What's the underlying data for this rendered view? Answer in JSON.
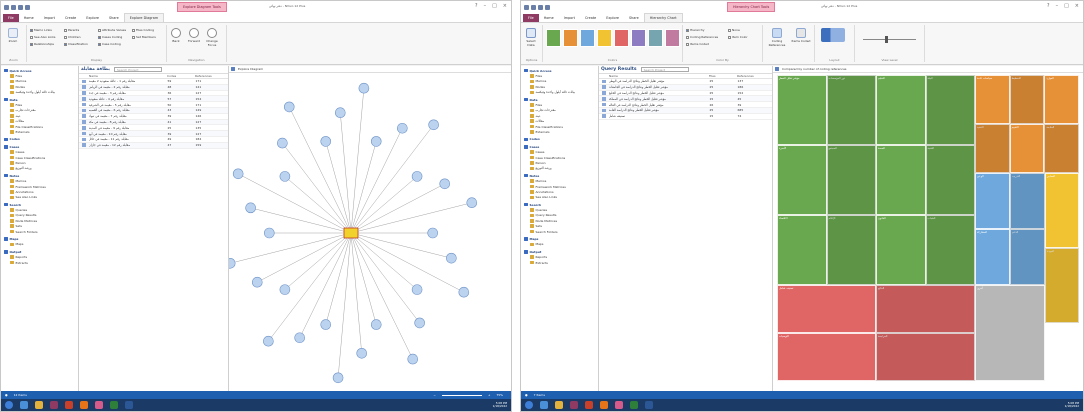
{
  "window1": {
    "title": "دفتر نهائي - NVivo 12 Plus",
    "context_tab": "Explore Diagram Tools",
    "ribbon_tabs": [
      "File",
      "Home",
      "Import",
      "Create",
      "Explore",
      "Share",
      "Explore Diagram"
    ],
    "ribbon": {
      "zoom": "Zoom",
      "show_group": [
        {
          "label": "Memo Links",
          "on": true
        },
        {
          "label": "See Also Links",
          "on": false
        },
        {
          "label": "Relationships",
          "on": true
        },
        {
          "label": "Parents",
          "on": false
        },
        {
          "label": "Children",
          "on": false
        },
        {
          "label": "Classification",
          "on": true
        },
        {
          "label": "Attribute Values",
          "on": false
        },
        {
          "label": "Cases Coding",
          "on": true
        },
        {
          "label": "Case Coding",
          "on": true
        },
        {
          "label": "Files Coding",
          "on": false
        },
        {
          "label": "Set Members",
          "on": false
        }
      ],
      "group_labels": [
        "Zoom",
        "Display",
        "Navigation"
      ],
      "nav_buttons": [
        "Back",
        "Forward",
        "Change Focus"
      ]
    },
    "nav": {
      "sections": [
        {
          "title": "Quick Access",
          "items": [
            "Files",
            "Memos",
            "Nodes",
            "بيانات ثالثة أيلول واحدة وفيكسة"
          ]
        },
        {
          "title": "Data",
          "items": [
            "Files",
            "مقترحات تجارب",
            "عينة",
            "مقالات",
            "File Classifications",
            "Externals"
          ]
        },
        {
          "title": "Codes",
          "items": []
        },
        {
          "title": "Cases",
          "items": [
            "Cases",
            "Case Classifications",
            "Person",
            "ورشة التوزيع"
          ]
        },
        {
          "title": "Notes",
          "items": [
            "Memos",
            "Framework Matrices",
            "Annotations",
            "See Also Links"
          ]
        },
        {
          "title": "Search",
          "items": [
            "Queries",
            "Query Results",
            "Node Matrices",
            "Sets",
            "Search Folders"
          ]
        },
        {
          "title": "Maps",
          "items": [
            "Maps"
          ]
        },
        {
          "title": "Output",
          "items": [
            "Reports",
            "Extracts"
          ]
        }
      ]
    },
    "list": {
      "title": "بطاقة مقابلة",
      "search_placeholder": "Search Project",
      "columns": [
        "Name",
        "Codes",
        "References"
      ],
      "rows": [
        {
          "name": "مقابلة رقم 1 - عائلة سعودية 2 مقيمة",
          "codes": "59",
          "refs": "171"
        },
        {
          "name": "مقابلة رقم 2 - مقيمة في الرياض",
          "codes": "48",
          "refs": "141"
        },
        {
          "name": "مقابلة رقم 3 - مقيمة في جدة",
          "codes": "36",
          "refs": "127"
        },
        {
          "name": "مقابلة رقم 4 - عائلة سعودية",
          "codes": "57",
          "refs": "154"
        },
        {
          "name": "مقابلة رقم 5 - مقيمة في الشرقية",
          "codes": "50",
          "refs": "171"
        },
        {
          "name": "مقابلة رقم 6 - مقيمة في القصيم",
          "codes": "43",
          "refs": "149"
        },
        {
          "name": "مقابلة رقم 7 - مقيمة في تبوك",
          "codes": "39",
          "refs": "146"
        },
        {
          "name": "مقابلة رقم 8 - مقيمة في مكة",
          "codes": "41",
          "refs": "127"
        },
        {
          "name": "مقابلة رقم 9 - مقيمة في المدينة",
          "codes": "25",
          "refs": "135"
        },
        {
          "name": "مقابلة رقم 10 - مقيمة في أبها",
          "codes": "39",
          "refs": "127"
        },
        {
          "name": "مقابلة رقم 11 - مقيمة في حائل",
          "codes": "49",
          "refs": "184"
        },
        {
          "name": "مقابلة رقم 12 - مقيمة في جازان",
          "codes": "47",
          "refs": "159"
        }
      ]
    },
    "detail_tab": "Explore Diagram",
    "status": {
      "items": "12 Items",
      "zoom_minus": "−",
      "zoom_plus": "+",
      "zoom": "75%"
    }
  },
  "window2": {
    "title": "دفتر نهائي - NVivo 12 Plus",
    "context_tab": "Hierarchy Chart Tools",
    "ribbon_tabs": [
      "File",
      "Home",
      "Import",
      "Create",
      "Explore",
      "Share",
      "Hierarchy Chart"
    ],
    "ribbon": {
      "select_data": "Select Data",
      "options_label": "Options",
      "colors_label": "Colors",
      "color_by_label": "Color By",
      "color_by": [
        {
          "label": "Hierarchy",
          "on": true
        },
        {
          "label": "Coding References",
          "on": false
        },
        {
          "label": "Items Coded",
          "on": false
        },
        {
          "label": "None",
          "on": false
        },
        {
          "label": "Item Color",
          "on": false
        }
      ],
      "size_by": [
        {
          "label": "Coding References",
          "on": true
        },
        {
          "label": "Items Coded",
          "on": false
        }
      ],
      "layout_label": "Layout",
      "view_level_label": "View Level",
      "palette": [
        "#6aa84f",
        "#e69138",
        "#6fa8dc",
        "#f1c232",
        "#e06666",
        "#8e7cc3",
        "#76a5af",
        "#c27ba0"
      ]
    },
    "list": {
      "title": "Query Results",
      "search_placeholder": "Search Project",
      "columns": [
        "Name",
        "Files",
        "References"
      ],
      "rows": [
        {
          "name": "مؤشر تقليل الخطر ونتائج الدراسة في الوطن",
          "files": "25",
          "refs": "137"
        },
        {
          "name": "مؤشر تقليل الخطر ونتائج الدراسة في الجامعات",
          "files": "25",
          "refs": "186"
        },
        {
          "name": "مؤشر تقليل الخطر ونتائج الدراسة في الخليج",
          "files": "25",
          "refs": "152"
        },
        {
          "name": "مؤشر تقليل الخطر ونتائج الدراسة في المملكة",
          "files": "15",
          "refs": "45"
        },
        {
          "name": "مؤشر تقليل الخطر ونتائج الدراسة في العالم",
          "files": "26",
          "refs": "39"
        },
        {
          "name": "مؤشر تقليل الخطر ونتائج الدراسة العامة",
          "files": "25",
          "refs": "685"
        },
        {
          "name": "تصنيف شامل",
          "files": "15",
          "refs": "74"
        }
      ]
    },
    "detail_tab": "Compared by number of coding references",
    "status": {
      "items": "7 Items"
    },
    "treemap_labels": {
      "green": [
        "مؤشر تقليل الخطر",
        "دور المؤسسات",
        "التعليم",
        "البيئة",
        "الأسرة",
        "المجتمع",
        "الصحة",
        "التقنية",
        "الاقتصاد",
        "الإعلام",
        "القانون",
        "الشباب"
      ],
      "orange": [
        "سياسات عامة",
        "التخطيط",
        "الموارد",
        "التنفيذ",
        "التقييم",
        "المتابعة"
      ],
      "blue": [
        "الوعي",
        "التدريب",
        "المشاركة",
        "الدعم"
      ],
      "yellow": [
        "المعايير",
        "الجودة"
      ],
      "red": [
        "تصنيف شامل",
        "النتائج",
        "التوصيات",
        "المراجعة"
      ],
      "gray": [
        "أخرى"
      ]
    }
  },
  "taskbar": {
    "time": "5:08 PM",
    "date": "1/18/2022",
    "time2": "5:08 PM",
    "date2": "1/18/2022"
  }
}
